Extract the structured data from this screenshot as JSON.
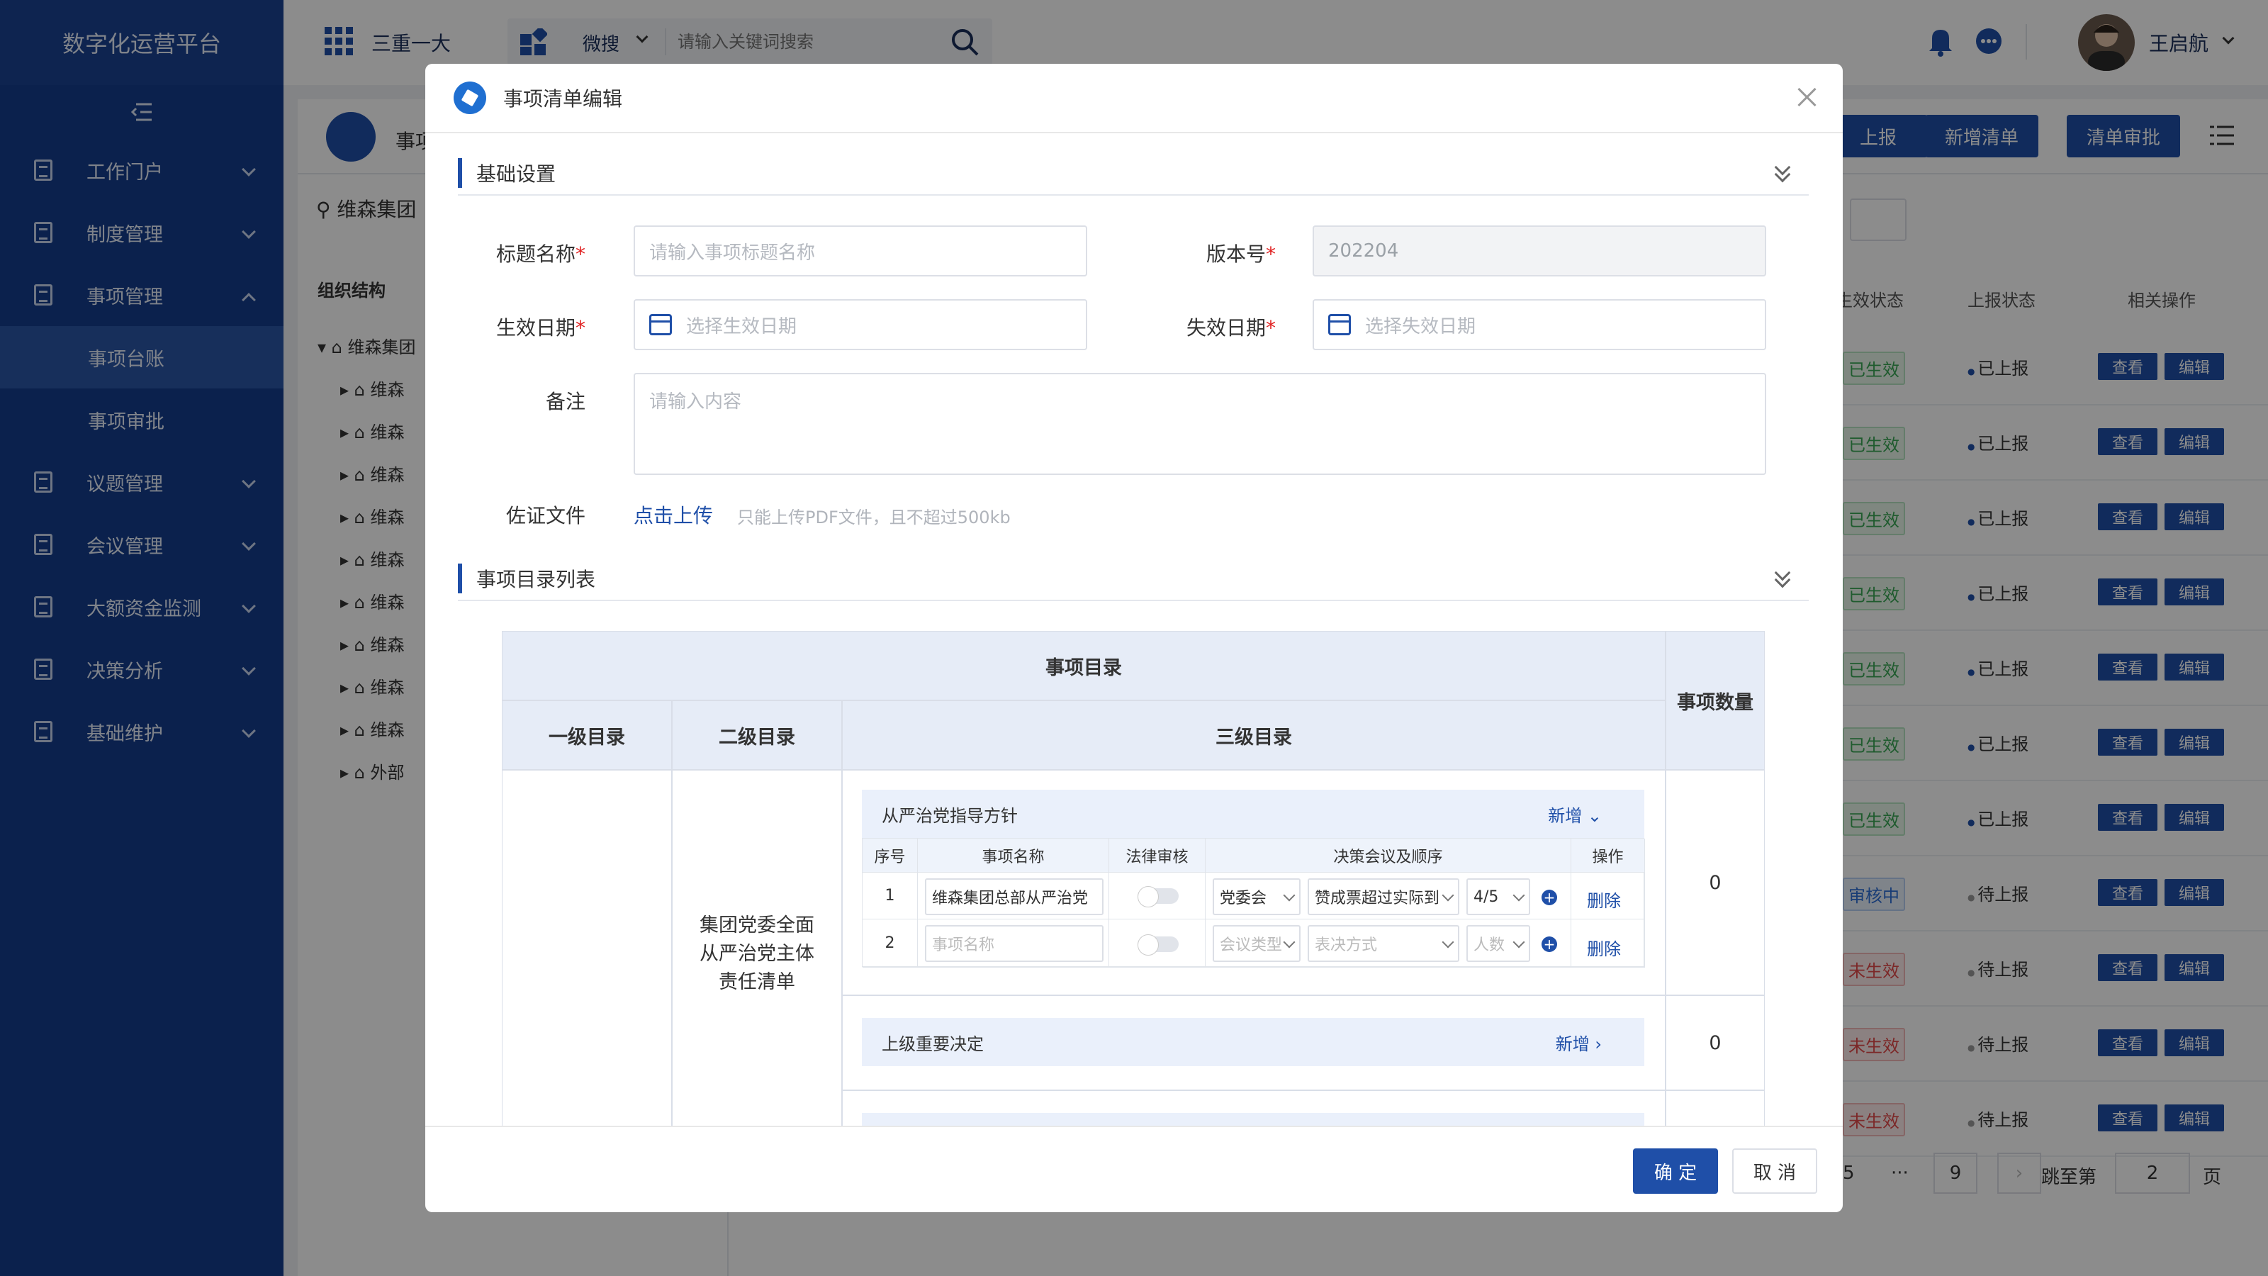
{
  "sidebar": {
    "title": "数字化运营平台",
    "items": [
      {
        "label": "工作门户",
        "expanded": false
      },
      {
        "label": "制度管理",
        "expanded": false
      },
      {
        "label": "事项管理",
        "expanded": true,
        "children": [
          "事项台账",
          "事项审批"
        ]
      },
      {
        "label": "议题管理",
        "expanded": false
      },
      {
        "label": "会议管理",
        "expanded": false
      },
      {
        "label": "大额资金监测",
        "expanded": false
      },
      {
        "label": "决策分析",
        "expanded": false
      },
      {
        "label": "基础维护",
        "expanded": false
      }
    ]
  },
  "topbar": {
    "app_name": "三重一大",
    "search_scope": "微搜",
    "search_placeholder": "请输入关键词搜索",
    "user_name": "王启航"
  },
  "page": {
    "title": "事项",
    "org_label": "维森集团",
    "tree_title": "组织结构",
    "tree_root": "维森集团",
    "tree_items": [
      "维森",
      "维森",
      "维森",
      "维森",
      "维森",
      "维森",
      "维森",
      "维森",
      "维森",
      "外部"
    ],
    "buttons": [
      "上报",
      "新增清单",
      "清单审批"
    ],
    "columns": [
      "生效状态",
      "上报状态",
      "相关操作"
    ],
    "rows": [
      {
        "status": "已生效",
        "report": "已上报"
      },
      {
        "status": "已生效",
        "report": "已上报"
      },
      {
        "status": "已生效",
        "report": "已上报"
      },
      {
        "status": "已生效",
        "report": "已上报"
      },
      {
        "status": "已生效",
        "report": "已上报"
      },
      {
        "status": "已生效",
        "report": "已上报"
      },
      {
        "status": "已生效",
        "report": "已上报"
      },
      {
        "status": "审核中",
        "report": "待上报"
      },
      {
        "status": "未生效",
        "report": "待上报"
      },
      {
        "status": "未生效",
        "report": "待上报"
      },
      {
        "status": "未生效",
        "report": "待上报"
      }
    ],
    "view_label": "查看",
    "edit_label": "编辑",
    "pager": {
      "pages": [
        "5",
        "···",
        "9"
      ],
      "jump_label": "跳至第",
      "jump_value": "2",
      "page_unit": "页"
    }
  },
  "modal": {
    "title": "事项清单编辑",
    "basic_section": "基础设置",
    "title_label": "标题名称",
    "title_placeholder": "请输入事项标题名称",
    "version_label": "版本号",
    "version_value": "202204",
    "start_label": "生效日期",
    "start_placeholder": "选择生效日期",
    "end_label": "失效日期",
    "end_placeholder": "选择失效日期",
    "note_label": "备注",
    "note_placeholder": "请输入内容",
    "file_label": "佐证文件",
    "upload_link": "点击上传",
    "upload_hint": "只能上传PDF文件，且不超过500kb",
    "list_section": "事项目录列表",
    "table": {
      "catalog": "事项目录",
      "count_col": "事项数量",
      "l1": "一级目录",
      "l2": "二级目录",
      "l3": "三级目录",
      "l2_value": "集团党委全面从严治党主体责任清单",
      "groups": [
        {
          "name": "从严治党指导方针",
          "add": "新增",
          "count": "0",
          "cols": [
            "序号",
            "事项名称",
            "法律审核",
            "决策会议及顺序",
            "操作"
          ],
          "rows": [
            {
              "no": "1",
              "name": "维森集团总部从严治党",
              "meeting": "党委会",
              "vote": "赞成票超过实际到",
              "ratio": "4/5",
              "del": "删除"
            },
            {
              "no": "2",
              "name": "事项名称",
              "meeting": "会议类型",
              "vote": "表决方式",
              "ratio": "人数",
              "del": "删除"
            }
          ]
        },
        {
          "name": "上级重要决定",
          "add": "新增",
          "count": "0"
        }
      ]
    },
    "confirm": "确 定",
    "cancel": "取 消"
  }
}
